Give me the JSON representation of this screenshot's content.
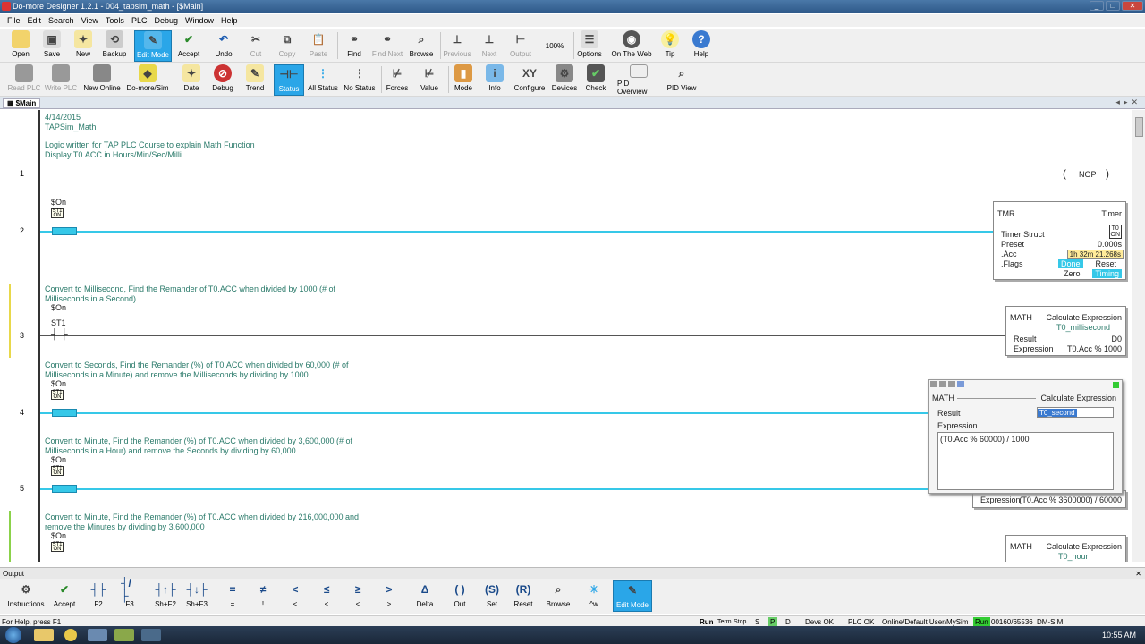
{
  "window": {
    "title": "Do-more Designer 1.2.1 - 004_tapsim_math - [$Main]"
  },
  "menu": [
    "File",
    "Edit",
    "Search",
    "View",
    "Tools",
    "PLC",
    "Debug",
    "Window",
    "Help"
  ],
  "toolbar1": [
    "Open",
    "Save",
    "New",
    "Backup",
    "Edit Mode",
    "Accept",
    "Undo",
    "Cut",
    "Copy",
    "Paste",
    "Find",
    "Find Next",
    "Browse",
    "Previous",
    "Next",
    "Output",
    "100%",
    "Options",
    "On The Web",
    "Tip",
    "Help"
  ],
  "toolbar2": [
    "Read PLC",
    "Write PLC",
    "New Online",
    "Do-more/Sim",
    "Date",
    "Debug",
    "Trend",
    "Status",
    "All Status",
    "No Status",
    "Forces",
    "Value",
    "Mode",
    "Info",
    "Configure",
    "Devices",
    "Check",
    "PID Overview",
    "PID View"
  ],
  "doc_tab": "$Main",
  "header_comment": [
    "4/14/2015",
    "TAPSim_Math",
    "",
    "Logic written for TAP PLC Course to explain Math Function",
    "Display T0.ACC in Hours/Min/Sec/Milli"
  ],
  "rungs": {
    "r1": {
      "num": "1",
      "coil": "NOP"
    },
    "r2": {
      "num": "2",
      "contact": "$On",
      "badge": "ST1 ON",
      "tmr": {
        "name": "TMR",
        "type": "Timer",
        "struct_label": "Timer Struct",
        "struct_val": "T0",
        "struct_state": "ON",
        "preset_label": "Preset",
        "preset_val": "0.000s",
        "acc_label": ".Acc",
        "acc_val": "1h 32m 21.268s",
        "flags_label": ".Flags",
        "done": "Done",
        "reset": "Reset",
        "zero": "Zero",
        "timing": "Timing"
      }
    },
    "r3": {
      "num": "3",
      "comment": [
        "Convert to Millisecond, Find the Remander of T0.ACC when divided by 1000 (# of",
        "Milliseconds in a Second)"
      ],
      "contact_top": "$On",
      "contact": "ST1",
      "math": {
        "name": "MATH",
        "type": "Calculate Expression",
        "subtitle": "T0_millisecond",
        "result_label": "Result",
        "result_val": "D0",
        "expr_label": "Expression",
        "expr_val": "T0.Acc % 1000"
      }
    },
    "r4": {
      "num": "4",
      "comment": [
        "Convert to Seconds, Find the Remander (%) of T0.ACC when divided by 60,000 (# of",
        "Milliseconds in a Minute) and remove the Milliseconds by dividing by 1000"
      ],
      "contact": "$On",
      "badge": "ST1 ON"
    },
    "r5": {
      "num": "5",
      "comment": [
        "Convert to Minute, Find the Remander (%) of T0.ACC when divided by 3,600,000 (# of",
        "Milliseconds in a Hour) and remove the Seconds by dividing by 60,000"
      ],
      "contact": "$On",
      "badge": "ST1 ON",
      "expr_label": "Expression",
      "expr_val": "(T0.Acc % 3600000) / 60000"
    },
    "r6": {
      "comment": [
        "Convert to Minute, Find the Remander (%) of T0.ACC when divided by 216,000,000 and",
        "remove the Minutes by dividing by 3,600,000"
      ],
      "contact": "$On",
      "badge": "ST1 ON",
      "math": {
        "name": "MATH",
        "type": "Calculate Expression",
        "subtitle": "T0_hour"
      }
    }
  },
  "popup": {
    "name": "MATH",
    "type": "Calculate Expression",
    "result_label": "Result",
    "result_val": "T0_second",
    "expr_label": "Expression",
    "expr_val": "(T0.Acc % 60000) / 1000"
  },
  "output_label": "Output",
  "toolbar3": [
    "Instructions",
    "Accept",
    "F2",
    "F3",
    "Sh+F2",
    "Sh+F3",
    "=",
    "!",
    "<",
    "<",
    "<",
    ">",
    ">",
    "Delta",
    "Out",
    "Set",
    "Reset",
    "Browse",
    "^w",
    "Edit Mode"
  ],
  "status": {
    "help": "For Help, press F1",
    "run": "Run",
    "term": "Term",
    "stop": "Stop",
    "s": "S",
    "p": "P",
    "d": "D",
    "devs": "Devs OK",
    "plc": "PLC OK",
    "online": "Online/Default User/MySim",
    "run2": "Run",
    "mem": "00160/65536",
    "sim": "DM-SIM"
  },
  "clock": "10:55 AM",
  "colors": {
    "accent": "#2aa6e8",
    "contact": "#36c8e8",
    "comment": "#2a7a6a",
    "active_bar": "#8bd24a"
  }
}
